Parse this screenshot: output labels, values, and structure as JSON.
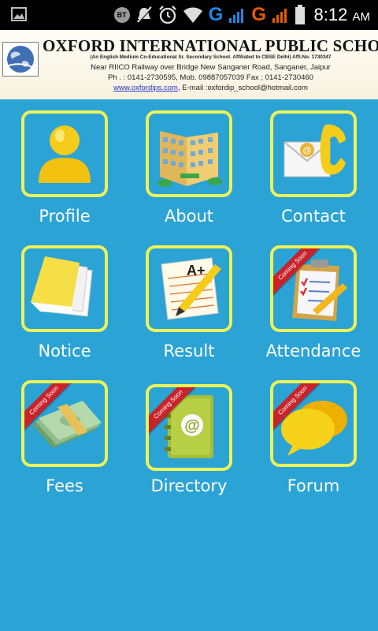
{
  "status_bar": {
    "bt_label": "BT",
    "network_letter_1": "G",
    "network_letter_2": "G",
    "time": "8:12",
    "ampm": "AM",
    "icons": [
      "image-icon",
      "bluetooth-icon",
      "mute-icon",
      "alarm-icon",
      "wifi-icon",
      "signal-icon",
      "battery-icon"
    ]
  },
  "header": {
    "school_name": "OXFORD INTERNATIONAL PUBLIC SCHOOL",
    "subtitle": "(An English Medium Co-Educational Sr. Secondary School. Affiliated to CBSE Delhi) Affi.No. 1730347",
    "address": "Near RIICO Railway over Bridge New Sanganer Road, Sanganer, Jaipur",
    "phone": "Ph . : 0141-2730595, Mob. 09887057039 Fax ; 0141-2730460",
    "website": "www.oxfordips.com",
    "email": ", E-mail :oxfordip_school@hotmail.com"
  },
  "tiles": [
    {
      "label": "Profile",
      "icon": "person-icon",
      "coming_soon": false
    },
    {
      "label": "About",
      "icon": "building-icon",
      "coming_soon": false
    },
    {
      "label": "Contact",
      "icon": "envelope-phone-icon",
      "coming_soon": false
    },
    {
      "label": "Notice",
      "icon": "notepad-icon",
      "coming_soon": false
    },
    {
      "label": "Result",
      "icon": "grade-sheet-icon",
      "coming_soon": false
    },
    {
      "label": "Attendance",
      "icon": "clipboard-icon",
      "coming_soon": true
    },
    {
      "label": "Fees",
      "icon": "money-icon",
      "coming_soon": true
    },
    {
      "label": "Directory",
      "icon": "address-book-icon",
      "coming_soon": true
    },
    {
      "label": "Forum",
      "icon": "chat-bubbles-icon",
      "coming_soon": true
    }
  ],
  "ribbon_text": "Coming Soon",
  "colors": {
    "background": "#2ba3d4",
    "tile_border": "#ecf35a",
    "ribbon": "#c8232a"
  }
}
